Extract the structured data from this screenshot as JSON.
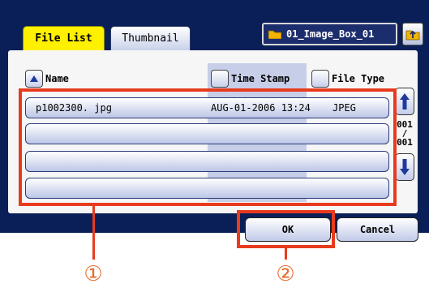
{
  "tabs": {
    "file_list": "File List",
    "thumbnail": "Thumbnail"
  },
  "folder": {
    "name": "01_Image_Box_01",
    "icon": "folder-icon",
    "up_icon": "folder-up-icon"
  },
  "columns": {
    "name": "Name",
    "time_stamp": "Time Stamp",
    "file_type": "File Type"
  },
  "files": [
    {
      "name": "p1002300. jpg",
      "time": "AUG-01-2006 13:24",
      "type": "JPEG"
    },
    {
      "name": "",
      "time": "",
      "type": ""
    },
    {
      "name": "",
      "time": "",
      "type": ""
    },
    {
      "name": "",
      "time": "",
      "type": ""
    }
  ],
  "paging": {
    "current": "001",
    "separator": "/",
    "total": "001"
  },
  "buttons": {
    "ok": "OK",
    "cancel": "Cancel"
  },
  "callouts": {
    "one": "①",
    "two": "②"
  },
  "colors": {
    "panel": "#0a1f57",
    "active_tab": "#fff000",
    "callout": "#e83b1e"
  }
}
